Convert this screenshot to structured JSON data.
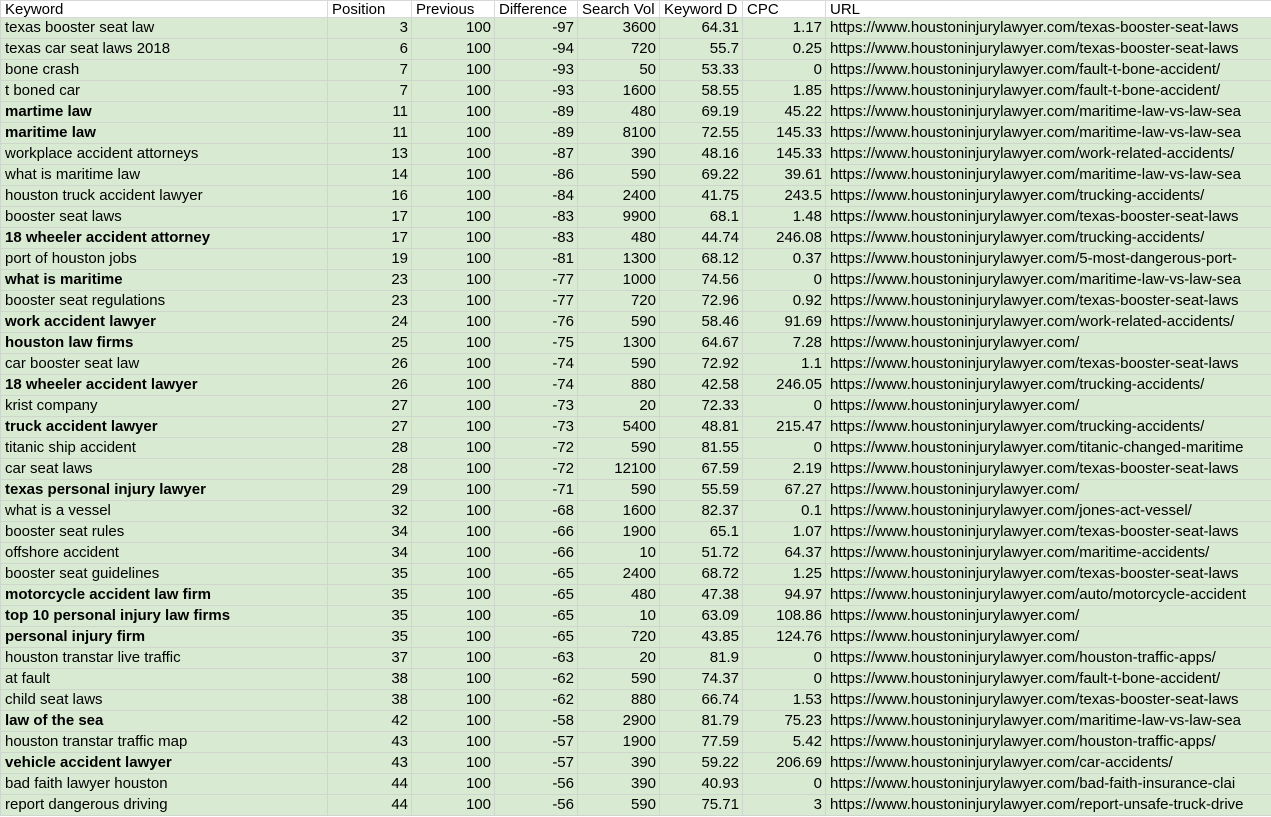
{
  "columns": [
    "Keyword",
    "Position",
    "Previous",
    "Difference",
    "Search Vol",
    "Keyword D",
    "CPC",
    "URL"
  ],
  "rows": [
    {
      "keyword": "texas booster seat law",
      "bold": false,
      "position": "3",
      "previous": "100",
      "difference": "-97",
      "search_vol": "3600",
      "kd": "64.31",
      "cpc": "1.17",
      "url": "https://www.houstoninjurylawyer.com/texas-booster-seat-laws"
    },
    {
      "keyword": "texas car seat laws 2018",
      "bold": false,
      "position": "6",
      "previous": "100",
      "difference": "-94",
      "search_vol": "720",
      "kd": "55.7",
      "cpc": "0.25",
      "url": "https://www.houstoninjurylawyer.com/texas-booster-seat-laws"
    },
    {
      "keyword": "bone crash",
      "bold": false,
      "position": "7",
      "previous": "100",
      "difference": "-93",
      "search_vol": "50",
      "kd": "53.33",
      "cpc": "0",
      "url": "https://www.houstoninjurylawyer.com/fault-t-bone-accident/"
    },
    {
      "keyword": "t boned car",
      "bold": false,
      "position": "7",
      "previous": "100",
      "difference": "-93",
      "search_vol": "1600",
      "kd": "58.55",
      "cpc": "1.85",
      "url": "https://www.houstoninjurylawyer.com/fault-t-bone-accident/"
    },
    {
      "keyword": "martime law",
      "bold": true,
      "position": "11",
      "previous": "100",
      "difference": "-89",
      "search_vol": "480",
      "kd": "69.19",
      "cpc": "45.22",
      "url": "https://www.houstoninjurylawyer.com/maritime-law-vs-law-sea"
    },
    {
      "keyword": "maritime law",
      "bold": true,
      "position": "11",
      "previous": "100",
      "difference": "-89",
      "search_vol": "8100",
      "kd": "72.55",
      "cpc": "145.33",
      "url": "https://www.houstoninjurylawyer.com/maritime-law-vs-law-sea"
    },
    {
      "keyword": "workplace accident attorneys",
      "bold": false,
      "position": "13",
      "previous": "100",
      "difference": "-87",
      "search_vol": "390",
      "kd": "48.16",
      "cpc": "145.33",
      "url": "https://www.houstoninjurylawyer.com/work-related-accidents/"
    },
    {
      "keyword": "what is maritime law",
      "bold": false,
      "position": "14",
      "previous": "100",
      "difference": "-86",
      "search_vol": "590",
      "kd": "69.22",
      "cpc": "39.61",
      "url": "https://www.houstoninjurylawyer.com/maritime-law-vs-law-sea"
    },
    {
      "keyword": "houston truck accident lawyer",
      "bold": false,
      "position": "16",
      "previous": "100",
      "difference": "-84",
      "search_vol": "2400",
      "kd": "41.75",
      "cpc": "243.5",
      "url": "https://www.houstoninjurylawyer.com/trucking-accidents/"
    },
    {
      "keyword": "booster seat laws",
      "bold": false,
      "position": "17",
      "previous": "100",
      "difference": "-83",
      "search_vol": "9900",
      "kd": "68.1",
      "cpc": "1.48",
      "url": "https://www.houstoninjurylawyer.com/texas-booster-seat-laws"
    },
    {
      "keyword": "18 wheeler accident attorney",
      "bold": true,
      "position": "17",
      "previous": "100",
      "difference": "-83",
      "search_vol": "480",
      "kd": "44.74",
      "cpc": "246.08",
      "url": "https://www.houstoninjurylawyer.com/trucking-accidents/"
    },
    {
      "keyword": "port of houston jobs",
      "bold": false,
      "position": "19",
      "previous": "100",
      "difference": "-81",
      "search_vol": "1300",
      "kd": "68.12",
      "cpc": "0.37",
      "url": "https://www.houstoninjurylawyer.com/5-most-dangerous-port-"
    },
    {
      "keyword": "what is maritime",
      "bold": true,
      "position": "23",
      "previous": "100",
      "difference": "-77",
      "search_vol": "1000",
      "kd": "74.56",
      "cpc": "0",
      "url": "https://www.houstoninjurylawyer.com/maritime-law-vs-law-sea"
    },
    {
      "keyword": "booster seat regulations",
      "bold": false,
      "position": "23",
      "previous": "100",
      "difference": "-77",
      "search_vol": "720",
      "kd": "72.96",
      "cpc": "0.92",
      "url": "https://www.houstoninjurylawyer.com/texas-booster-seat-laws"
    },
    {
      "keyword": "work accident lawyer",
      "bold": true,
      "position": "24",
      "previous": "100",
      "difference": "-76",
      "search_vol": "590",
      "kd": "58.46",
      "cpc": "91.69",
      "url": "https://www.houstoninjurylawyer.com/work-related-accidents/"
    },
    {
      "keyword": "houston law firms",
      "bold": true,
      "position": "25",
      "previous": "100",
      "difference": "-75",
      "search_vol": "1300",
      "kd": "64.67",
      "cpc": "7.28",
      "url": "https://www.houstoninjurylawyer.com/"
    },
    {
      "keyword": "car booster seat law",
      "bold": false,
      "position": "26",
      "previous": "100",
      "difference": "-74",
      "search_vol": "590",
      "kd": "72.92",
      "cpc": "1.1",
      "url": "https://www.houstoninjurylawyer.com/texas-booster-seat-laws"
    },
    {
      "keyword": "18 wheeler accident lawyer",
      "bold": true,
      "position": "26",
      "previous": "100",
      "difference": "-74",
      "search_vol": "880",
      "kd": "42.58",
      "cpc": "246.05",
      "url": "https://www.houstoninjurylawyer.com/trucking-accidents/"
    },
    {
      "keyword": "krist company",
      "bold": false,
      "position": "27",
      "previous": "100",
      "difference": "-73",
      "search_vol": "20",
      "kd": "72.33",
      "cpc": "0",
      "url": "https://www.houstoninjurylawyer.com/"
    },
    {
      "keyword": "truck accident lawyer",
      "bold": true,
      "position": "27",
      "previous": "100",
      "difference": "-73",
      "search_vol": "5400",
      "kd": "48.81",
      "cpc": "215.47",
      "url": "https://www.houstoninjurylawyer.com/trucking-accidents/"
    },
    {
      "keyword": "titanic ship accident",
      "bold": false,
      "position": "28",
      "previous": "100",
      "difference": "-72",
      "search_vol": "590",
      "kd": "81.55",
      "cpc": "0",
      "url": "https://www.houstoninjurylawyer.com/titanic-changed-maritime"
    },
    {
      "keyword": "car seat laws",
      "bold": false,
      "position": "28",
      "previous": "100",
      "difference": "-72",
      "search_vol": "12100",
      "kd": "67.59",
      "cpc": "2.19",
      "url": "https://www.houstoninjurylawyer.com/texas-booster-seat-laws"
    },
    {
      "keyword": "texas personal injury lawyer",
      "bold": true,
      "position": "29",
      "previous": "100",
      "difference": "-71",
      "search_vol": "590",
      "kd": "55.59",
      "cpc": "67.27",
      "url": "https://www.houstoninjurylawyer.com/"
    },
    {
      "keyword": "what is a vessel",
      "bold": false,
      "position": "32",
      "previous": "100",
      "difference": "-68",
      "search_vol": "1600",
      "kd": "82.37",
      "cpc": "0.1",
      "url": "https://www.houstoninjurylawyer.com/jones-act-vessel/"
    },
    {
      "keyword": "booster seat rules",
      "bold": false,
      "position": "34",
      "previous": "100",
      "difference": "-66",
      "search_vol": "1900",
      "kd": "65.1",
      "cpc": "1.07",
      "url": "https://www.houstoninjurylawyer.com/texas-booster-seat-laws"
    },
    {
      "keyword": "offshore accident",
      "bold": false,
      "position": "34",
      "previous": "100",
      "difference": "-66",
      "search_vol": "10",
      "kd": "51.72",
      "cpc": "64.37",
      "url": "https://www.houstoninjurylawyer.com/maritime-accidents/"
    },
    {
      "keyword": "booster seat guidelines",
      "bold": false,
      "position": "35",
      "previous": "100",
      "difference": "-65",
      "search_vol": "2400",
      "kd": "68.72",
      "cpc": "1.25",
      "url": "https://www.houstoninjurylawyer.com/texas-booster-seat-laws"
    },
    {
      "keyword": "motorcycle accident law firm",
      "bold": true,
      "position": "35",
      "previous": "100",
      "difference": "-65",
      "search_vol": "480",
      "kd": "47.38",
      "cpc": "94.97",
      "url": "https://www.houstoninjurylawyer.com/auto/motorcycle-accident"
    },
    {
      "keyword": "top 10 personal injury law firms",
      "bold": true,
      "position": "35",
      "previous": "100",
      "difference": "-65",
      "search_vol": "10",
      "kd": "63.09",
      "cpc": "108.86",
      "url": "https://www.houstoninjurylawyer.com/"
    },
    {
      "keyword": "personal injury firm",
      "bold": true,
      "position": "35",
      "previous": "100",
      "difference": "-65",
      "search_vol": "720",
      "kd": "43.85",
      "cpc": "124.76",
      "url": "https://www.houstoninjurylawyer.com/"
    },
    {
      "keyword": "houston transtar live traffic",
      "bold": false,
      "position": "37",
      "previous": "100",
      "difference": "-63",
      "search_vol": "20",
      "kd": "81.9",
      "cpc": "0",
      "url": "https://www.houstoninjurylawyer.com/houston-traffic-apps/"
    },
    {
      "keyword": "at fault",
      "bold": false,
      "position": "38",
      "previous": "100",
      "difference": "-62",
      "search_vol": "590",
      "kd": "74.37",
      "cpc": "0",
      "url": "https://www.houstoninjurylawyer.com/fault-t-bone-accident/"
    },
    {
      "keyword": "child seat laws",
      "bold": false,
      "position": "38",
      "previous": "100",
      "difference": "-62",
      "search_vol": "880",
      "kd": "66.74",
      "cpc": "1.53",
      "url": "https://www.houstoninjurylawyer.com/texas-booster-seat-laws"
    },
    {
      "keyword": "law of the sea",
      "bold": true,
      "position": "42",
      "previous": "100",
      "difference": "-58",
      "search_vol": "2900",
      "kd": "81.79",
      "cpc": "75.23",
      "url": "https://www.houstoninjurylawyer.com/maritime-law-vs-law-sea"
    },
    {
      "keyword": "houston transtar traffic map",
      "bold": false,
      "position": "43",
      "previous": "100",
      "difference": "-57",
      "search_vol": "1900",
      "kd": "77.59",
      "cpc": "5.42",
      "url": "https://www.houstoninjurylawyer.com/houston-traffic-apps/"
    },
    {
      "keyword": "vehicle accident lawyer",
      "bold": true,
      "position": "43",
      "previous": "100",
      "difference": "-57",
      "search_vol": "390",
      "kd": "59.22",
      "cpc": "206.69",
      "url": "https://www.houstoninjurylawyer.com/car-accidents/"
    },
    {
      "keyword": "bad faith lawyer houston",
      "bold": false,
      "position": "44",
      "previous": "100",
      "difference": "-56",
      "search_vol": "390",
      "kd": "40.93",
      "cpc": "0",
      "url": "https://www.houstoninjurylawyer.com/bad-faith-insurance-clai"
    },
    {
      "keyword": "report dangerous driving",
      "bold": false,
      "position": "44",
      "previous": "100",
      "difference": "-56",
      "search_vol": "590",
      "kd": "75.71",
      "cpc": "3",
      "url": "https://www.houstoninjurylawyer.com/report-unsafe-truck-drive"
    }
  ],
  "colors": {
    "cell_bg": "#d9ead3",
    "header_bg": "#ffffff",
    "grid": "#cfd6cd"
  }
}
